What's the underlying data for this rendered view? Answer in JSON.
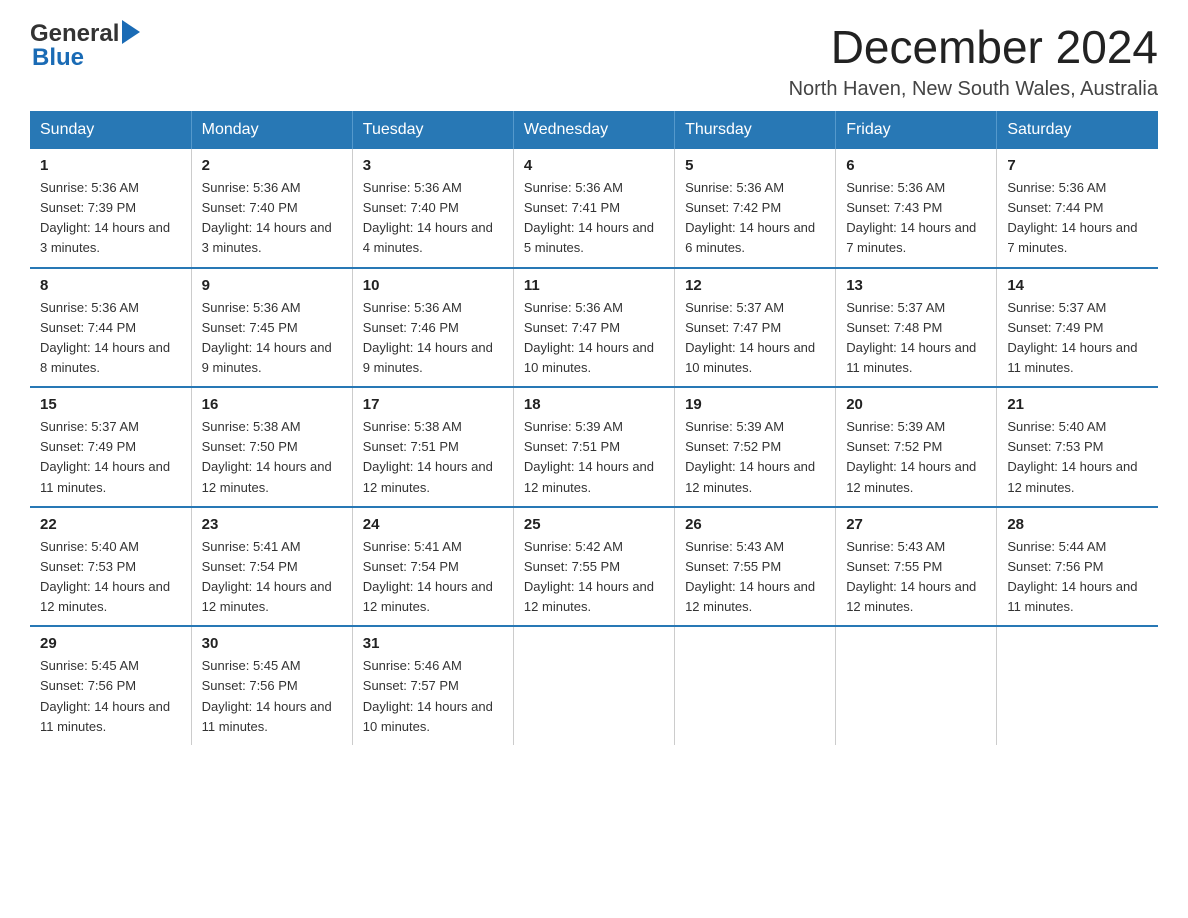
{
  "header": {
    "logo_general": "General",
    "logo_blue": "Blue",
    "title": "December 2024",
    "subtitle": "North Haven, New South Wales, Australia"
  },
  "days_of_week": [
    "Sunday",
    "Monday",
    "Tuesday",
    "Wednesday",
    "Thursday",
    "Friday",
    "Saturday"
  ],
  "weeks": [
    [
      {
        "day": "1",
        "sunrise": "Sunrise: 5:36 AM",
        "sunset": "Sunset: 7:39 PM",
        "daylight": "Daylight: 14 hours and 3 minutes."
      },
      {
        "day": "2",
        "sunrise": "Sunrise: 5:36 AM",
        "sunset": "Sunset: 7:40 PM",
        "daylight": "Daylight: 14 hours and 3 minutes."
      },
      {
        "day": "3",
        "sunrise": "Sunrise: 5:36 AM",
        "sunset": "Sunset: 7:40 PM",
        "daylight": "Daylight: 14 hours and 4 minutes."
      },
      {
        "day": "4",
        "sunrise": "Sunrise: 5:36 AM",
        "sunset": "Sunset: 7:41 PM",
        "daylight": "Daylight: 14 hours and 5 minutes."
      },
      {
        "day": "5",
        "sunrise": "Sunrise: 5:36 AM",
        "sunset": "Sunset: 7:42 PM",
        "daylight": "Daylight: 14 hours and 6 minutes."
      },
      {
        "day": "6",
        "sunrise": "Sunrise: 5:36 AM",
        "sunset": "Sunset: 7:43 PM",
        "daylight": "Daylight: 14 hours and 7 minutes."
      },
      {
        "day": "7",
        "sunrise": "Sunrise: 5:36 AM",
        "sunset": "Sunset: 7:44 PM",
        "daylight": "Daylight: 14 hours and 7 minutes."
      }
    ],
    [
      {
        "day": "8",
        "sunrise": "Sunrise: 5:36 AM",
        "sunset": "Sunset: 7:44 PM",
        "daylight": "Daylight: 14 hours and 8 minutes."
      },
      {
        "day": "9",
        "sunrise": "Sunrise: 5:36 AM",
        "sunset": "Sunset: 7:45 PM",
        "daylight": "Daylight: 14 hours and 9 minutes."
      },
      {
        "day": "10",
        "sunrise": "Sunrise: 5:36 AM",
        "sunset": "Sunset: 7:46 PM",
        "daylight": "Daylight: 14 hours and 9 minutes."
      },
      {
        "day": "11",
        "sunrise": "Sunrise: 5:36 AM",
        "sunset": "Sunset: 7:47 PM",
        "daylight": "Daylight: 14 hours and 10 minutes."
      },
      {
        "day": "12",
        "sunrise": "Sunrise: 5:37 AM",
        "sunset": "Sunset: 7:47 PM",
        "daylight": "Daylight: 14 hours and 10 minutes."
      },
      {
        "day": "13",
        "sunrise": "Sunrise: 5:37 AM",
        "sunset": "Sunset: 7:48 PM",
        "daylight": "Daylight: 14 hours and 11 minutes."
      },
      {
        "day": "14",
        "sunrise": "Sunrise: 5:37 AM",
        "sunset": "Sunset: 7:49 PM",
        "daylight": "Daylight: 14 hours and 11 minutes."
      }
    ],
    [
      {
        "day": "15",
        "sunrise": "Sunrise: 5:37 AM",
        "sunset": "Sunset: 7:49 PM",
        "daylight": "Daylight: 14 hours and 11 minutes."
      },
      {
        "day": "16",
        "sunrise": "Sunrise: 5:38 AM",
        "sunset": "Sunset: 7:50 PM",
        "daylight": "Daylight: 14 hours and 12 minutes."
      },
      {
        "day": "17",
        "sunrise": "Sunrise: 5:38 AM",
        "sunset": "Sunset: 7:51 PM",
        "daylight": "Daylight: 14 hours and 12 minutes."
      },
      {
        "day": "18",
        "sunrise": "Sunrise: 5:39 AM",
        "sunset": "Sunset: 7:51 PM",
        "daylight": "Daylight: 14 hours and 12 minutes."
      },
      {
        "day": "19",
        "sunrise": "Sunrise: 5:39 AM",
        "sunset": "Sunset: 7:52 PM",
        "daylight": "Daylight: 14 hours and 12 minutes."
      },
      {
        "day": "20",
        "sunrise": "Sunrise: 5:39 AM",
        "sunset": "Sunset: 7:52 PM",
        "daylight": "Daylight: 14 hours and 12 minutes."
      },
      {
        "day": "21",
        "sunrise": "Sunrise: 5:40 AM",
        "sunset": "Sunset: 7:53 PM",
        "daylight": "Daylight: 14 hours and 12 minutes."
      }
    ],
    [
      {
        "day": "22",
        "sunrise": "Sunrise: 5:40 AM",
        "sunset": "Sunset: 7:53 PM",
        "daylight": "Daylight: 14 hours and 12 minutes."
      },
      {
        "day": "23",
        "sunrise": "Sunrise: 5:41 AM",
        "sunset": "Sunset: 7:54 PM",
        "daylight": "Daylight: 14 hours and 12 minutes."
      },
      {
        "day": "24",
        "sunrise": "Sunrise: 5:41 AM",
        "sunset": "Sunset: 7:54 PM",
        "daylight": "Daylight: 14 hours and 12 minutes."
      },
      {
        "day": "25",
        "sunrise": "Sunrise: 5:42 AM",
        "sunset": "Sunset: 7:55 PM",
        "daylight": "Daylight: 14 hours and 12 minutes."
      },
      {
        "day": "26",
        "sunrise": "Sunrise: 5:43 AM",
        "sunset": "Sunset: 7:55 PM",
        "daylight": "Daylight: 14 hours and 12 minutes."
      },
      {
        "day": "27",
        "sunrise": "Sunrise: 5:43 AM",
        "sunset": "Sunset: 7:55 PM",
        "daylight": "Daylight: 14 hours and 12 minutes."
      },
      {
        "day": "28",
        "sunrise": "Sunrise: 5:44 AM",
        "sunset": "Sunset: 7:56 PM",
        "daylight": "Daylight: 14 hours and 11 minutes."
      }
    ],
    [
      {
        "day": "29",
        "sunrise": "Sunrise: 5:45 AM",
        "sunset": "Sunset: 7:56 PM",
        "daylight": "Daylight: 14 hours and 11 minutes."
      },
      {
        "day": "30",
        "sunrise": "Sunrise: 5:45 AM",
        "sunset": "Sunset: 7:56 PM",
        "daylight": "Daylight: 14 hours and 11 minutes."
      },
      {
        "day": "31",
        "sunrise": "Sunrise: 5:46 AM",
        "sunset": "Sunset: 7:57 PM",
        "daylight": "Daylight: 14 hours and 10 minutes."
      },
      null,
      null,
      null,
      null
    ]
  ]
}
